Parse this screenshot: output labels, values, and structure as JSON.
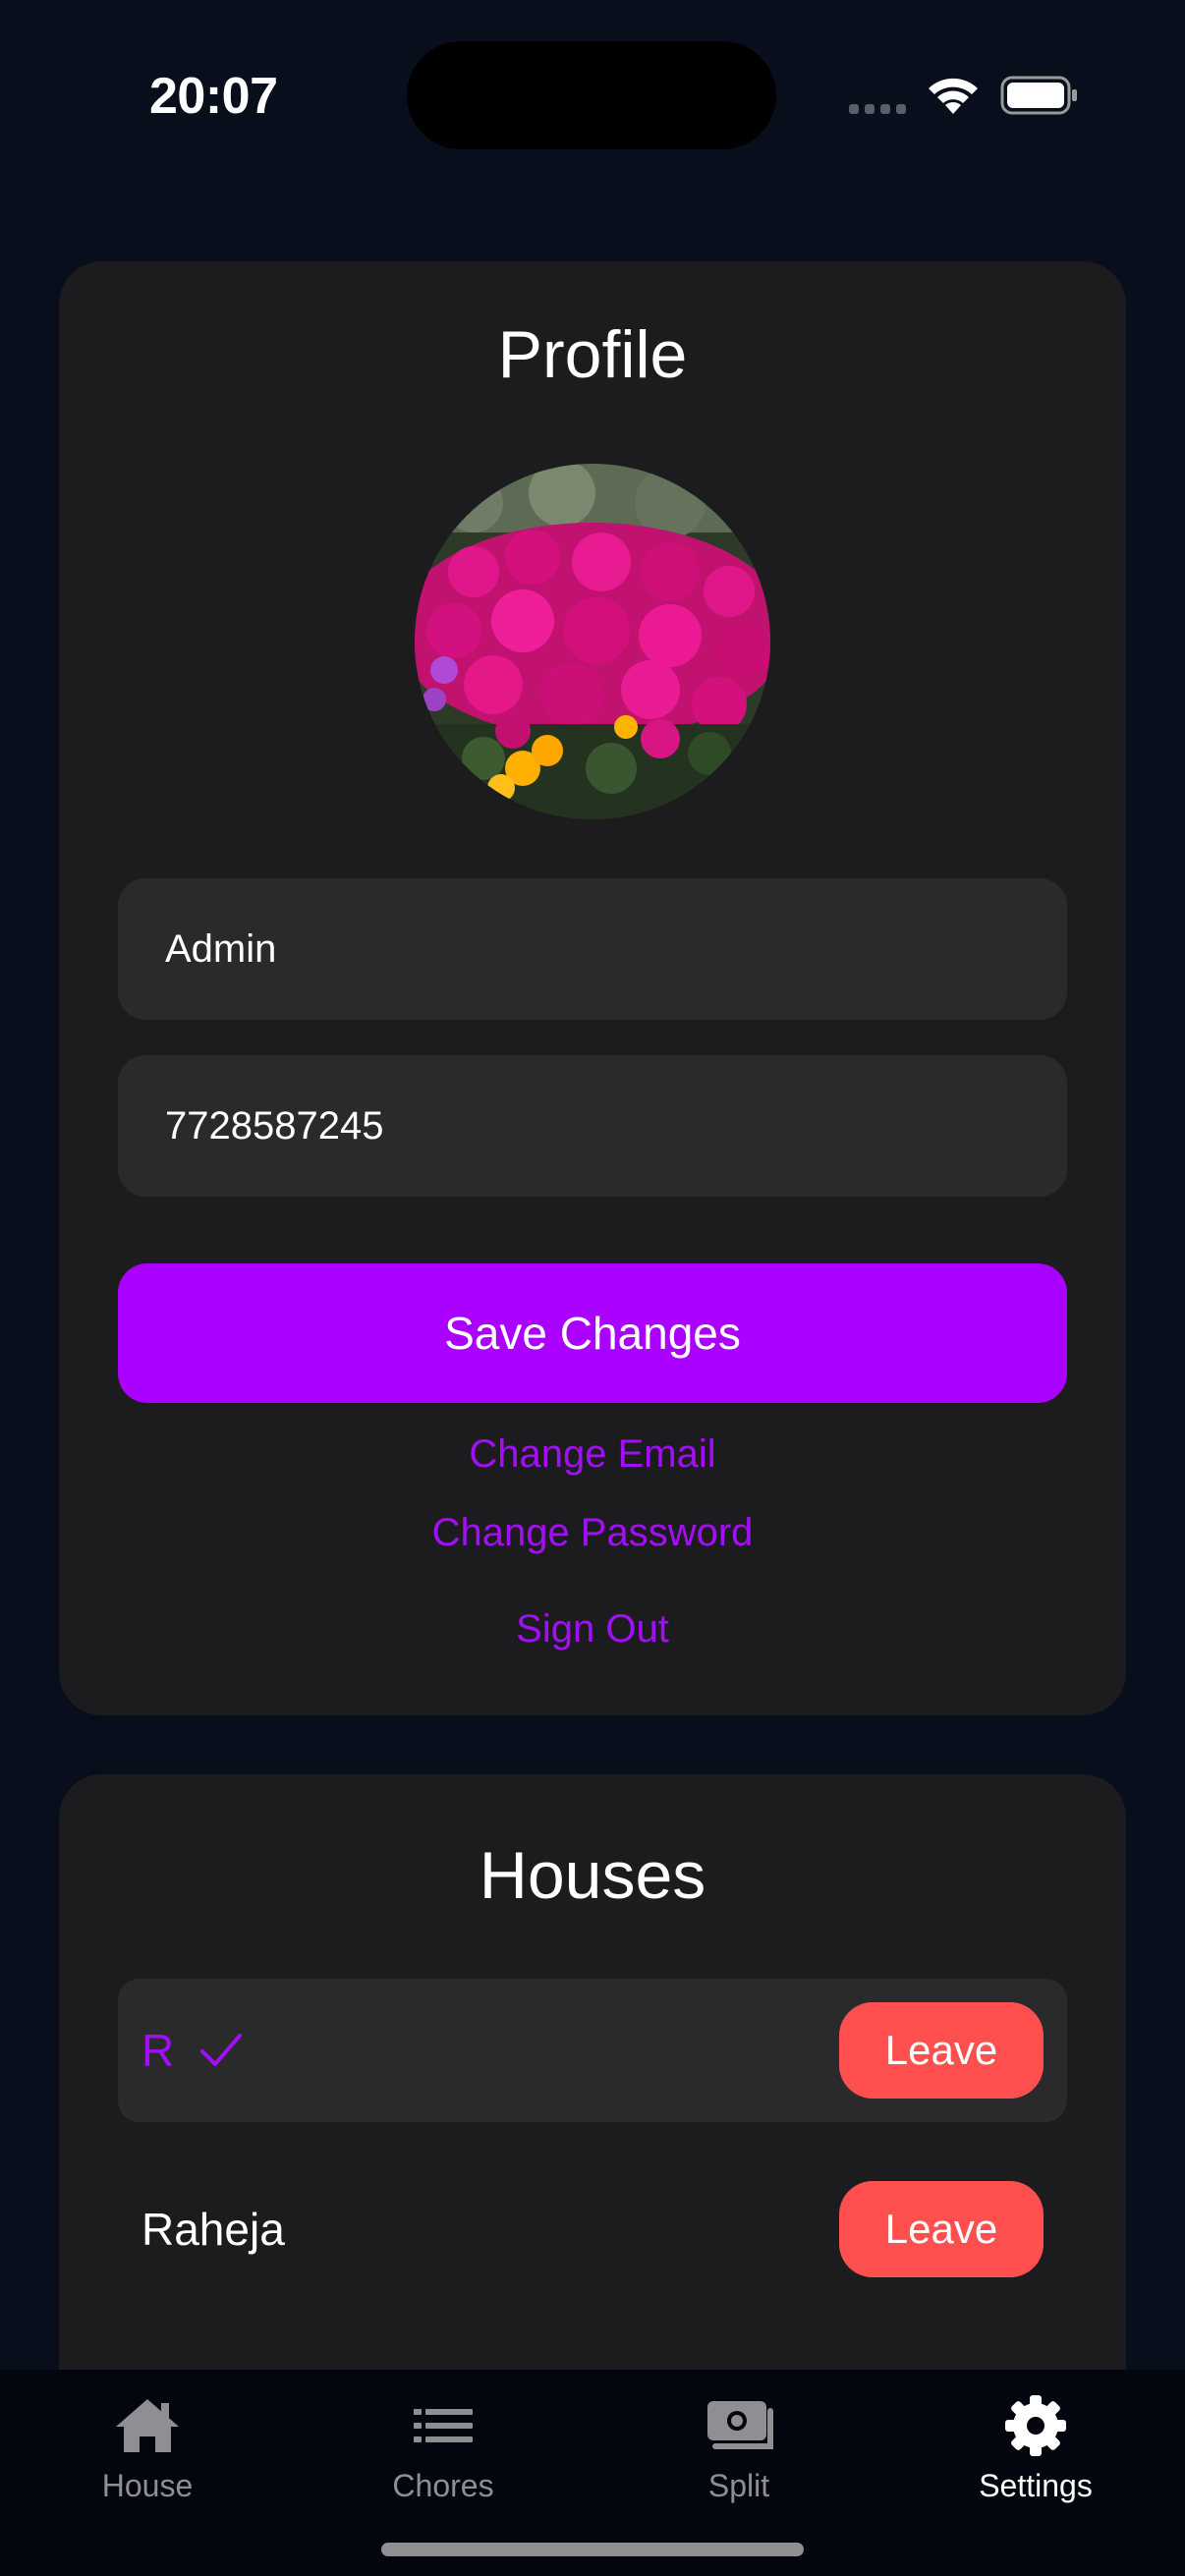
{
  "status_bar": {
    "time": "20:07"
  },
  "profile": {
    "title": "Profile",
    "avatar_alt": "profile photo",
    "name_value": "Admin",
    "phone_value": "7728587245",
    "save_label": "Save Changes",
    "change_email_label": "Change Email",
    "change_password_label": "Change Password",
    "sign_out_label": "Sign Out"
  },
  "houses": {
    "title": "Houses",
    "items": [
      {
        "name": "R",
        "selected": true,
        "leave_label": "Leave"
      },
      {
        "name": "Raheja",
        "selected": false,
        "leave_label": "Leave"
      }
    ]
  },
  "tab_bar": {
    "tabs": [
      {
        "label": "House",
        "icon": "house-icon",
        "active": false
      },
      {
        "label": "Chores",
        "icon": "list-icon",
        "active": false
      },
      {
        "label": "Split",
        "icon": "money-icon",
        "active": false
      },
      {
        "label": "Settings",
        "icon": "gear-icon",
        "active": true
      }
    ]
  },
  "colors": {
    "background": "#090e1d",
    "card": "#1c1c1e",
    "field": "#2a2a2c",
    "accent": "#aa00ff",
    "link": "#a20ef5",
    "danger": "#ff4f4f",
    "tab_inactive": "#8e8e93"
  }
}
